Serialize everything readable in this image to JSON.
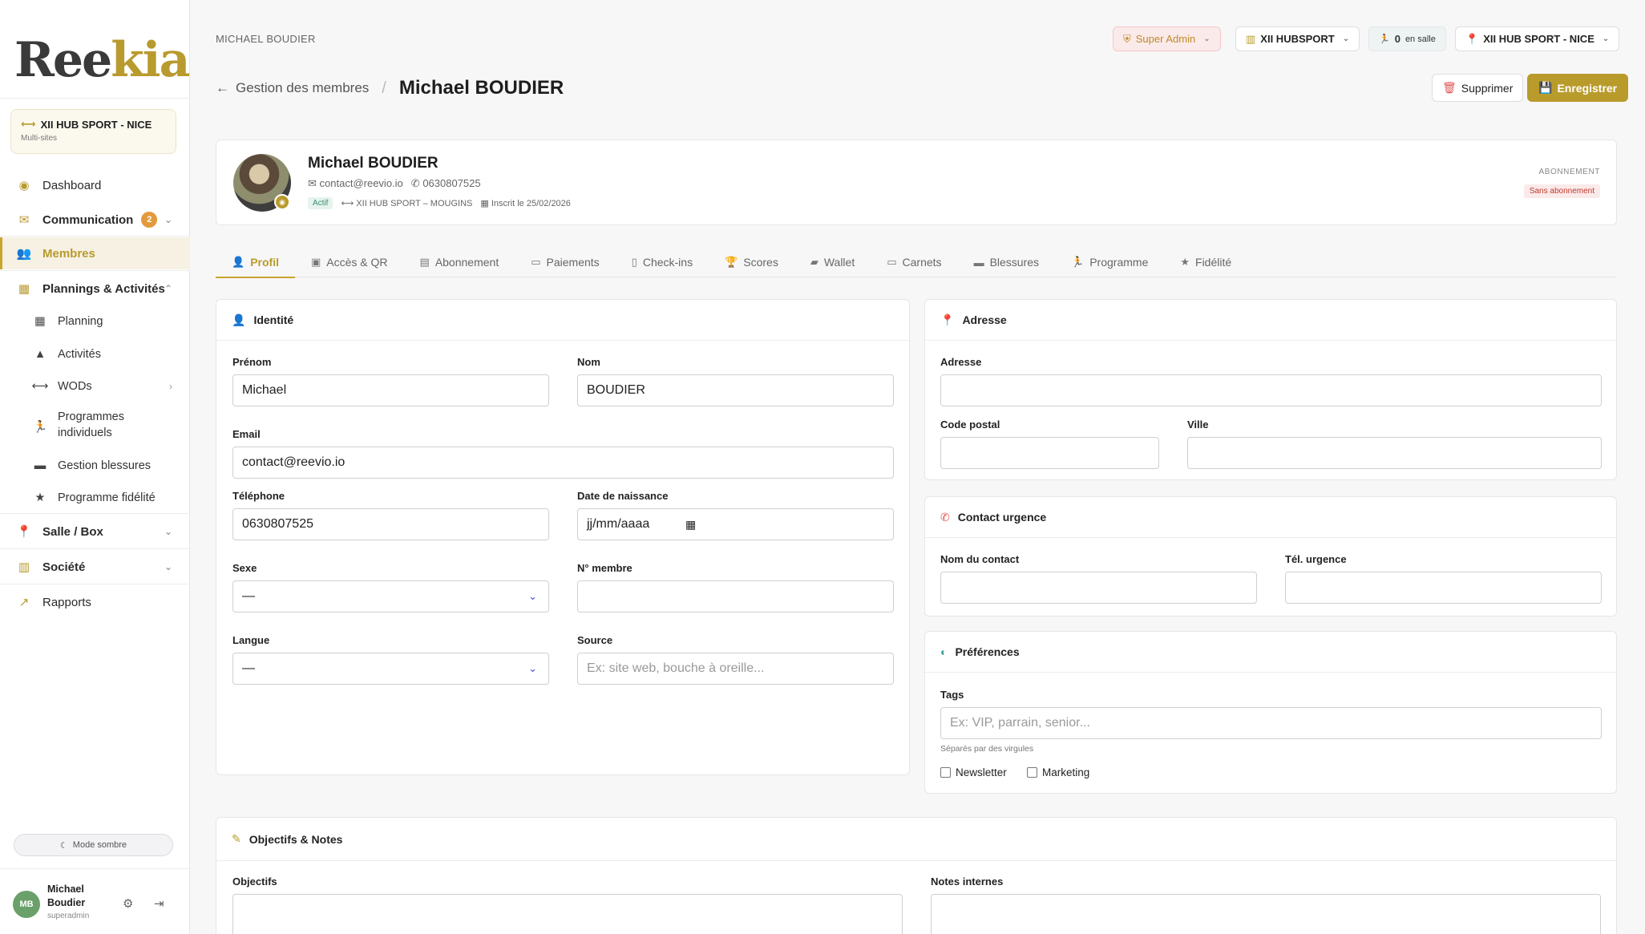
{
  "brand": {
    "logo_text_a": "Ree",
    "logo_text_b": "kia"
  },
  "sidebar": {
    "site": {
      "name": "XII HUB SPORT - NICE",
      "sub": "Multi-sites"
    },
    "items": [
      {
        "label": "Dashboard",
        "icon": "palette-icon"
      },
      {
        "label": "Communication",
        "icon": "megaphone-icon",
        "badge": "2"
      },
      {
        "label": "Membres",
        "icon": "users-icon"
      },
      {
        "label": "Plannings & Activités",
        "icon": "calendar-icon"
      },
      {
        "label": "Salle / Box",
        "icon": "location-pin-icon"
      },
      {
        "label": "Société",
        "icon": "building-icon"
      },
      {
        "label": "Rapports",
        "icon": "chart-line-icon"
      }
    ],
    "subitems": [
      {
        "label": "Planning",
        "icon": "calendar-grid-icon"
      },
      {
        "label": "Activités",
        "icon": "shapes-icon"
      },
      {
        "label": "WODs",
        "icon": "dumbbell-icon"
      },
      {
        "label": "Programmes individuels",
        "icon": "running-icon"
      },
      {
        "label": "Gestion blessures",
        "icon": "bandage-icon"
      },
      {
        "label": "Programme fidélité",
        "icon": "star-icon"
      }
    ],
    "dark_mode": "Mode sombre",
    "user": {
      "initials": "MB",
      "name": "Michael Boudier",
      "role": "superadmin"
    }
  },
  "topbar": {
    "breadcrumb": "MICHAEL BOUDIER",
    "admin": "Super Admin",
    "org": "XII HUBSPORT",
    "salle_count": "0",
    "salle_label": "en salle",
    "site": "XII HUB SPORT - NICE"
  },
  "header": {
    "back": "Gestion des membres",
    "title": "Michael BOUDIER",
    "delete": "Supprimer",
    "save": "Enregistrer"
  },
  "profile": {
    "name": "Michael BOUDIER",
    "email": "contact@reevio.io",
    "phone": "0630807525",
    "status": "Actif",
    "site": "XII HUB SPORT – MOUGINS",
    "registered": "Inscrit le 25/02/2026",
    "abo_label": "ABONNEMENT",
    "abo_status": "Sans abonnement"
  },
  "tabs": [
    {
      "label": "Profil",
      "icon": "user-icon"
    },
    {
      "label": "Accès & QR",
      "icon": "qr-icon"
    },
    {
      "label": "Abonnement",
      "icon": "id-card-icon"
    },
    {
      "label": "Paiements",
      "icon": "credit-card-icon"
    },
    {
      "label": "Check-ins",
      "icon": "door-icon"
    },
    {
      "label": "Scores",
      "icon": "trophy-icon"
    },
    {
      "label": "Wallet",
      "icon": "wallet-icon"
    },
    {
      "label": "Carnets",
      "icon": "ticket-icon"
    },
    {
      "label": "Blessures",
      "icon": "bandage-icon"
    },
    {
      "label": "Programme",
      "icon": "running-icon"
    },
    {
      "label": "Fidélité",
      "icon": "star-icon"
    }
  ],
  "identity": {
    "title": "Identité",
    "prenom_label": "Prénom",
    "prenom": "Michael",
    "nom_label": "Nom",
    "nom": "BOUDIER",
    "email_label": "Email",
    "email": "contact@reevio.io",
    "tel_label": "Téléphone",
    "tel": "0630807525",
    "dob_label": "Date de naissance",
    "dob_placeholder": "jj/mm/aaaa",
    "sexe_label": "Sexe",
    "sexe": "—",
    "num_label": "N° membre",
    "langue_label": "Langue",
    "langue": "—",
    "source_label": "Source",
    "source_placeholder": "Ex: site web, bouche à oreille..."
  },
  "address": {
    "title": "Adresse",
    "adresse_label": "Adresse",
    "cp_label": "Code postal",
    "ville_label": "Ville"
  },
  "emergency": {
    "title": "Contact urgence",
    "name_label": "Nom du contact",
    "tel_label": "Tél. urgence"
  },
  "prefs": {
    "title": "Préférences",
    "tags_label": "Tags",
    "tags_placeholder": "Ex: VIP, parrain, senior...",
    "tags_hint": "Séparés par des virgules",
    "newsletter": "Newsletter",
    "marketing": "Marketing"
  },
  "notes": {
    "title": "Objectifs & Notes",
    "objectifs_label": "Objectifs",
    "internes_label": "Notes internes"
  },
  "colors": {
    "accent": "#b99b2c",
    "danger": "#c0392b"
  }
}
